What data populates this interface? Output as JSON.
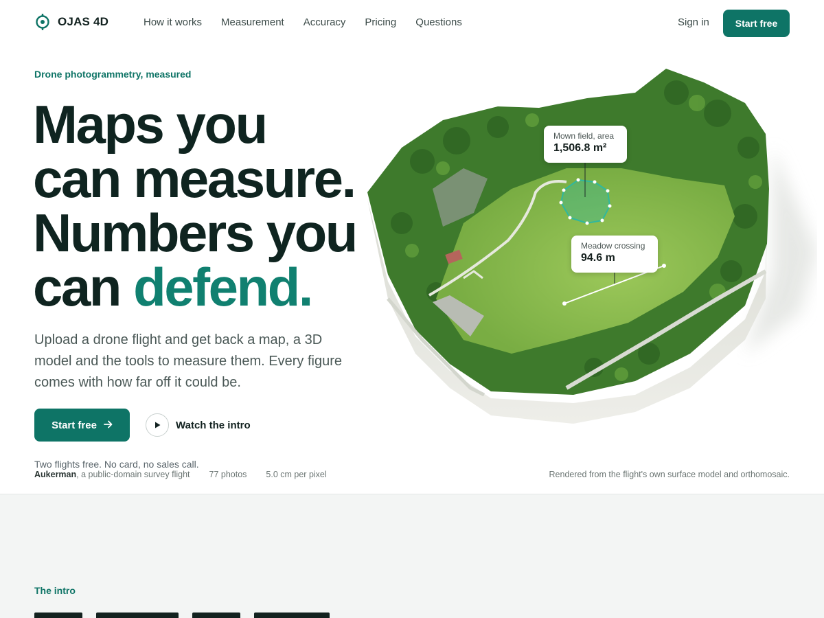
{
  "brand": {
    "name": "OJAS 4D"
  },
  "nav": {
    "links": [
      "How it works",
      "Measurement",
      "Accuracy",
      "Pricing",
      "Questions"
    ],
    "sign_in": "Sign in",
    "cta": "Start free"
  },
  "hero": {
    "eyebrow": "Drone photogrammetry, measured",
    "headline_line1": "Maps you",
    "headline_line2": "can measure.",
    "headline_line3": "Numbers you",
    "headline_line4_plain": "can ",
    "headline_line4_accent": "defend.",
    "subhead": "Upload a drone flight and get back a map, a 3D model and the tools to measure them. Every figure comes with how far off it could be.",
    "cta_primary": "Start free",
    "cta_primary_icon": "arrow-right-icon",
    "cta_secondary": "Watch the intro",
    "cta_secondary_icon": "play-icon",
    "fine_print": "Two flights free. No card, no sales call."
  },
  "flight_meta": {
    "name": "Aukerman",
    "description": ", a public-domain survey flight",
    "photos": "77 photos",
    "resolution": "5.0 cm per pixel",
    "render_note": "Rendered from the flight's own surface model and orthomosaic."
  },
  "map": {
    "area_callout": {
      "label": "Mown field, area",
      "value": "1,506.8 m²"
    },
    "distance_callout": {
      "label": "Meadow crossing",
      "value": "94.6 m"
    }
  },
  "next_section": {
    "eyebrow": "The intro"
  },
  "colors": {
    "accent": "#0e7466",
    "accent_text": "#108070",
    "ink": "#0f2420",
    "lower_bg": "#f3f5f4"
  }
}
